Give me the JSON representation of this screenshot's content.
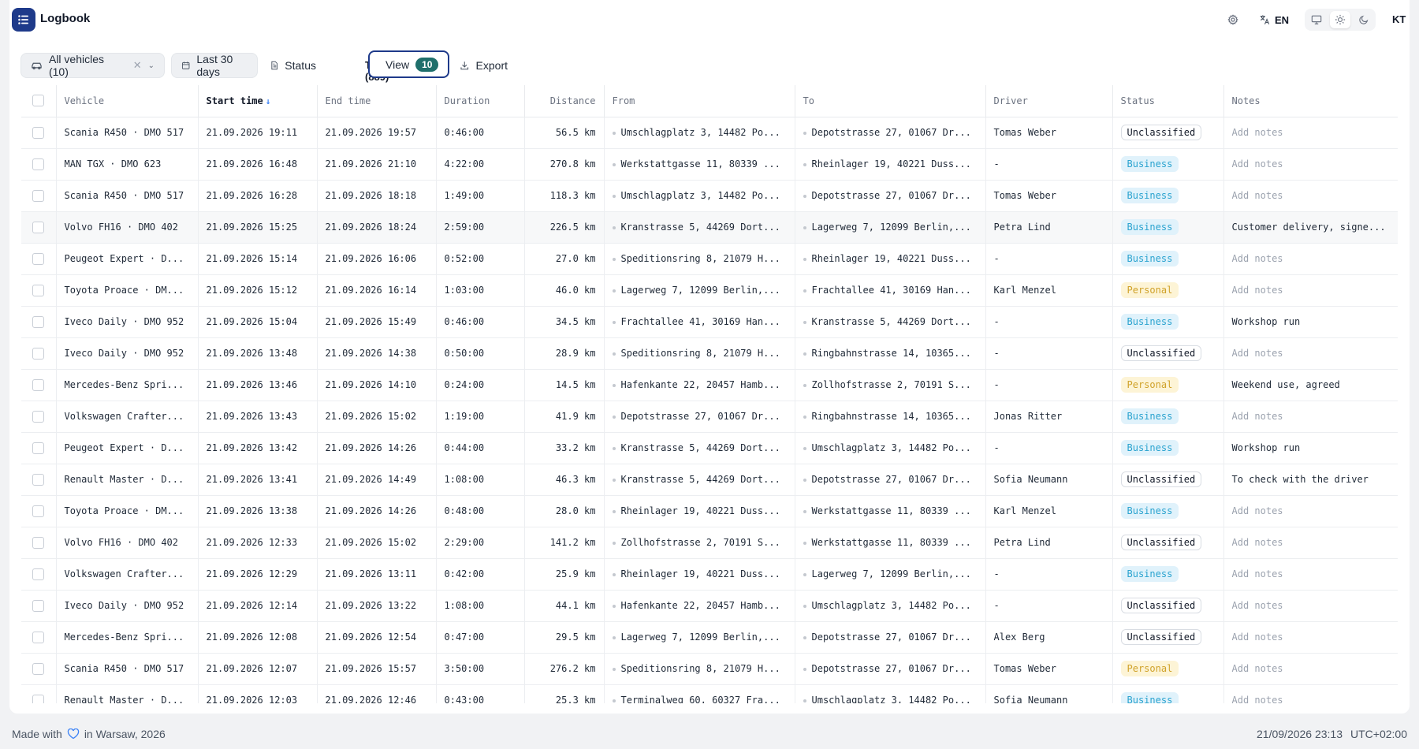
{
  "app": {
    "title": "Logbook"
  },
  "header": {
    "lang": "EN",
    "user_initials": "KT"
  },
  "toolbar": {
    "vehicles_label": "All vehicles (10)",
    "date_label": "Last 30 days",
    "status_label": "Status",
    "trips_label": "Trips (889)",
    "view_label": "View",
    "view_count": "10",
    "export_label": "Export"
  },
  "columns": {
    "vehicle": "Vehicle",
    "start_time": "Start time",
    "end_time": "End time",
    "duration": "Duration",
    "distance": "Distance",
    "from": "From",
    "to": "To",
    "driver": "Driver",
    "status": "Status",
    "notes": "Notes"
  },
  "rows": [
    {
      "vehicle": "Scania R450 · DMO 517",
      "start": "21.09.2026 19:11",
      "end": "21.09.2026 19:57",
      "duration": "0:46:00",
      "distance": "56.5 km",
      "from": "Umschlagplatz 3, 14482 Po...",
      "to": "Depotstrasse 27, 01067 Dr...",
      "driver": "Tomas Weber",
      "status": "Unclassified",
      "notes": "Add notes",
      "notes_empty": true
    },
    {
      "vehicle": "MAN TGX · DMO 623",
      "start": "21.09.2026 16:48",
      "end": "21.09.2026 21:10",
      "duration": "4:22:00",
      "distance": "270.8 km",
      "from": "Werkstattgasse 11, 80339 ...",
      "to": "Rheinlager 19, 40221 Duss...",
      "driver": "-",
      "status": "Business",
      "notes": "Add notes",
      "notes_empty": true
    },
    {
      "vehicle": "Scania R450 · DMO 517",
      "start": "21.09.2026 16:28",
      "end": "21.09.2026 18:18",
      "duration": "1:49:00",
      "distance": "118.3 km",
      "from": "Umschlagplatz 3, 14482 Po...",
      "to": "Depotstrasse 27, 01067 Dr...",
      "driver": "Tomas Weber",
      "status": "Business",
      "notes": "Add notes",
      "notes_empty": true
    },
    {
      "vehicle": "Volvo FH16 · DMO 402",
      "start": "21.09.2026 15:25",
      "end": "21.09.2026 18:24",
      "duration": "2:59:00",
      "distance": "226.5 km",
      "from": "Kranstrasse 5, 44269 Dort...",
      "to": "Lagerweg 7, 12099 Berlin,...",
      "driver": "Petra Lind",
      "status": "Business",
      "notes": "Customer delivery, signe...",
      "notes_empty": false
    },
    {
      "vehicle": "Peugeot Expert · D...",
      "start": "21.09.2026 15:14",
      "end": "21.09.2026 16:06",
      "duration": "0:52:00",
      "distance": "27.0 km",
      "from": "Speditionsring 8, 21079 H...",
      "to": "Rheinlager 19, 40221 Duss...",
      "driver": "-",
      "status": "Business",
      "notes": "Add notes",
      "notes_empty": true
    },
    {
      "vehicle": "Toyota Proace · DM...",
      "start": "21.09.2026 15:12",
      "end": "21.09.2026 16:14",
      "duration": "1:03:00",
      "distance": "46.0 km",
      "from": "Lagerweg 7, 12099 Berlin,...",
      "to": "Frachtallee 41, 30169 Han...",
      "driver": "Karl Menzel",
      "status": "Personal",
      "notes": "Add notes",
      "notes_empty": true
    },
    {
      "vehicle": "Iveco Daily · DMO 952",
      "start": "21.09.2026 15:04",
      "end": "21.09.2026 15:49",
      "duration": "0:46:00",
      "distance": "34.5 km",
      "from": "Frachtallee 41, 30169 Han...",
      "to": "Kranstrasse 5, 44269 Dort...",
      "driver": "-",
      "status": "Business",
      "notes": "Workshop run",
      "notes_empty": false
    },
    {
      "vehicle": "Iveco Daily · DMO 952",
      "start": "21.09.2026 13:48",
      "end": "21.09.2026 14:38",
      "duration": "0:50:00",
      "distance": "28.9 km",
      "from": "Speditionsring 8, 21079 H...",
      "to": "Ringbahnstrasse 14, 10365...",
      "driver": "-",
      "status": "Unclassified",
      "notes": "Add notes",
      "notes_empty": true
    },
    {
      "vehicle": "Mercedes-Benz Spri...",
      "start": "21.09.2026 13:46",
      "end": "21.09.2026 14:10",
      "duration": "0:24:00",
      "distance": "14.5 km",
      "from": "Hafenkante 22, 20457 Hamb...",
      "to": "Zollhofstrasse 2, 70191 S...",
      "driver": "-",
      "status": "Personal",
      "notes": "Weekend use, agreed",
      "notes_empty": false
    },
    {
      "vehicle": "Volkswagen Crafter...",
      "start": "21.09.2026 13:43",
      "end": "21.09.2026 15:02",
      "duration": "1:19:00",
      "distance": "41.9 km",
      "from": "Depotstrasse 27, 01067 Dr...",
      "to": "Ringbahnstrasse 14, 10365...",
      "driver": "Jonas Ritter",
      "status": "Business",
      "notes": "Add notes",
      "notes_empty": true
    },
    {
      "vehicle": "Peugeot Expert · D...",
      "start": "21.09.2026 13:42",
      "end": "21.09.2026 14:26",
      "duration": "0:44:00",
      "distance": "33.2 km",
      "from": "Kranstrasse 5, 44269 Dort...",
      "to": "Umschlagplatz 3, 14482 Po...",
      "driver": "-",
      "status": "Business",
      "notes": "Workshop run",
      "notes_empty": false
    },
    {
      "vehicle": "Renault Master · D...",
      "start": "21.09.2026 13:41",
      "end": "21.09.2026 14:49",
      "duration": "1:08:00",
      "distance": "46.3 km",
      "from": "Kranstrasse 5, 44269 Dort...",
      "to": "Depotstrasse 27, 01067 Dr...",
      "driver": "Sofia Neumann",
      "status": "Unclassified",
      "notes": "To check with the driver",
      "notes_empty": false
    },
    {
      "vehicle": "Toyota Proace · DM...",
      "start": "21.09.2026 13:38",
      "end": "21.09.2026 14:26",
      "duration": "0:48:00",
      "distance": "28.0 km",
      "from": "Rheinlager 19, 40221 Duss...",
      "to": "Werkstattgasse 11, 80339 ...",
      "driver": "Karl Menzel",
      "status": "Business",
      "notes": "Add notes",
      "notes_empty": true
    },
    {
      "vehicle": "Volvo FH16 · DMO 402",
      "start": "21.09.2026 12:33",
      "end": "21.09.2026 15:02",
      "duration": "2:29:00",
      "distance": "141.2 km",
      "from": "Zollhofstrasse 2, 70191 S...",
      "to": "Werkstattgasse 11, 80339 ...",
      "driver": "Petra Lind",
      "status": "Unclassified",
      "notes": "Add notes",
      "notes_empty": true
    },
    {
      "vehicle": "Volkswagen Crafter...",
      "start": "21.09.2026 12:29",
      "end": "21.09.2026 13:11",
      "duration": "0:42:00",
      "distance": "25.9 km",
      "from": "Rheinlager 19, 40221 Duss...",
      "to": "Lagerweg 7, 12099 Berlin,...",
      "driver": "-",
      "status": "Business",
      "notes": "Add notes",
      "notes_empty": true
    },
    {
      "vehicle": "Iveco Daily · DMO 952",
      "start": "21.09.2026 12:14",
      "end": "21.09.2026 13:22",
      "duration": "1:08:00",
      "distance": "44.1 km",
      "from": "Hafenkante 22, 20457 Hamb...",
      "to": "Umschlagplatz 3, 14482 Po...",
      "driver": "-",
      "status": "Unclassified",
      "notes": "Add notes",
      "notes_empty": true
    },
    {
      "vehicle": "Mercedes-Benz Spri...",
      "start": "21.09.2026 12:08",
      "end": "21.09.2026 12:54",
      "duration": "0:47:00",
      "distance": "29.5 km",
      "from": "Lagerweg 7, 12099 Berlin,...",
      "to": "Depotstrasse 27, 01067 Dr...",
      "driver": "Alex Berg",
      "status": "Unclassified",
      "notes": "Add notes",
      "notes_empty": true
    },
    {
      "vehicle": "Scania R450 · DMO 517",
      "start": "21.09.2026 12:07",
      "end": "21.09.2026 15:57",
      "duration": "3:50:00",
      "distance": "276.2 km",
      "from": "Speditionsring 8, 21079 H...",
      "to": "Depotstrasse 27, 01067 Dr...",
      "driver": "Tomas Weber",
      "status": "Personal",
      "notes": "Add notes",
      "notes_empty": true
    },
    {
      "vehicle": "Renault Master · D...",
      "start": "21.09.2026 12:03",
      "end": "21.09.2026 12:46",
      "duration": "0:43:00",
      "distance": "25.3 km",
      "from": "Terminalweg 60, 60327 Fra...",
      "to": "Umschlagplatz 3, 14482 Po...",
      "driver": "Sofia Neumann",
      "status": "Business",
      "notes": "Add notes",
      "notes_empty": true
    }
  ],
  "footer": {
    "made_with": "Made with",
    "in_location": "in Warsaw, 2026",
    "datetime": "21/09/2026 23:13",
    "timezone": "UTC+02:00"
  },
  "colors": {
    "brand": "#1e3a8a",
    "business": "#2aa3cf",
    "personal": "#d0a22a",
    "badge": "#1f6f6b"
  }
}
